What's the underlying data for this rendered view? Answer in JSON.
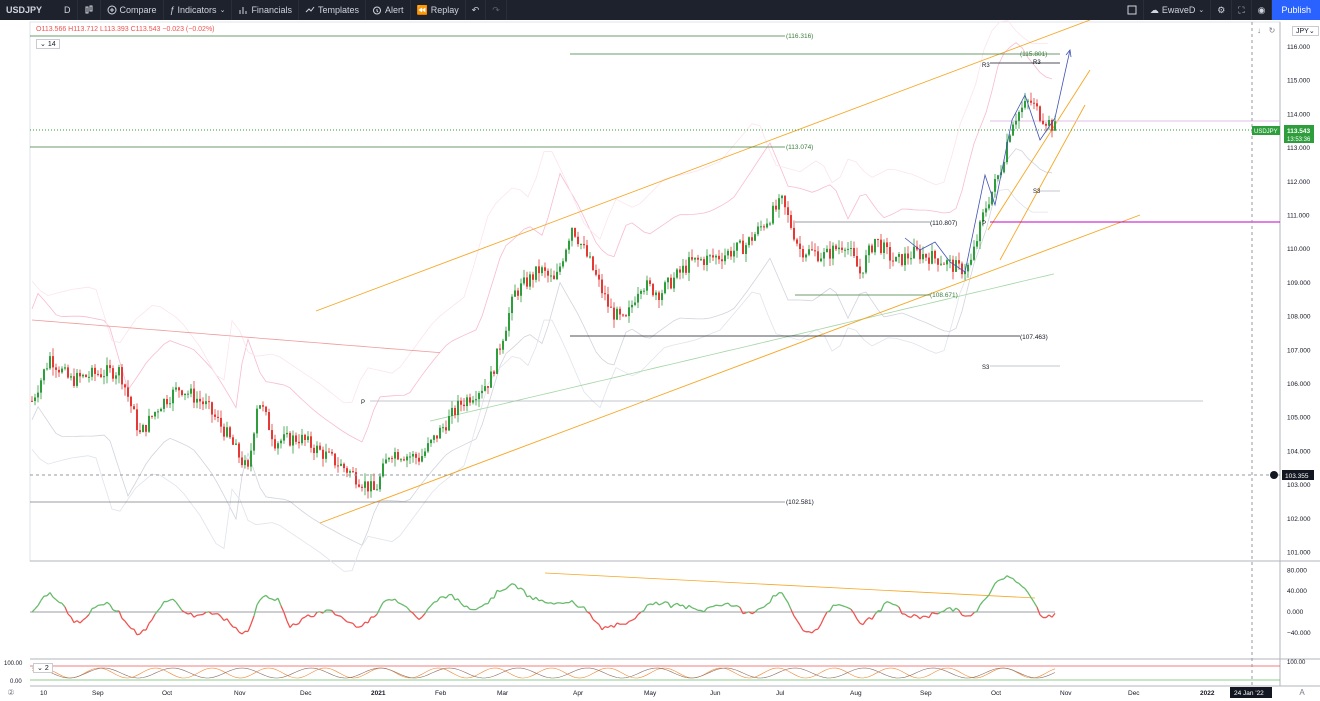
{
  "toolbar": {
    "symbol": "USDJPY",
    "interval": "D",
    "compare": "Compare",
    "indicators": "Indicators",
    "financials": "Financials",
    "templates": "Templates",
    "alert": "Alert",
    "replay": "Replay",
    "layout_name": "EwaveD",
    "publish": "Publish"
  },
  "legend": {
    "ohlc": "O113.566 H113.712 L113.393 C113.543 −0.023 (−0.02%)",
    "indicator_count": "14",
    "lower_indicator_count": "2"
  },
  "price_scale": {
    "currency": "JPY",
    "ticks": [
      "116.000",
      "115.000",
      "114.000",
      "113.000",
      "112.000",
      "111.000",
      "110.000",
      "109.000",
      "108.000",
      "107.000",
      "106.000",
      "105.000",
      "104.000",
      "103.000",
      "102.000",
      "101.000"
    ],
    "symbol_tag": "USDJPY",
    "last_price": "113.543",
    "countdown": "13:53:36",
    "crosshair_price": "103.355"
  },
  "osc_scale": {
    "ticks": [
      "80.000",
      "40.000",
      "0.000",
      "−40.000"
    ]
  },
  "stoch_scale": {
    "left_top": "100.00",
    "left_bottom": "0.00",
    "right_top": "100.00"
  },
  "time_axis": {
    "labels": [
      "10",
      "Sep",
      "Oct",
      "Nov",
      "Dec",
      "2021",
      "Feb",
      "Mar",
      "Apr",
      "May",
      "Jun",
      "Jul",
      "Aug",
      "Sep",
      "Oct",
      "Nov",
      "Dec",
      "2022"
    ],
    "crosshair_date": "24 Jan '22"
  },
  "annotations": {
    "level_116": "(116.316)",
    "level_115": "(115.801)",
    "level_113": "(113.074)",
    "level_110": "(110.807)",
    "level_108": "(108.671)",
    "level_107": "(107.463)",
    "level_102": "(102.581)",
    "pivot_r3": "R3",
    "pivot_r3b": "R3",
    "pivot_s3": "S3",
    "pivot_s3b": "S3",
    "pivot_p": "P",
    "pivot_p2": "P"
  },
  "colors": {
    "up": "#26a69a",
    "candle_up": "#2e9e3c",
    "candle_down": "#e53935",
    "channel": "#f5a623",
    "level_green": "#3b7d3b",
    "osc_up": "#66bb6a",
    "osc_down": "#ef5350",
    "magenta": "#c200c2"
  }
}
